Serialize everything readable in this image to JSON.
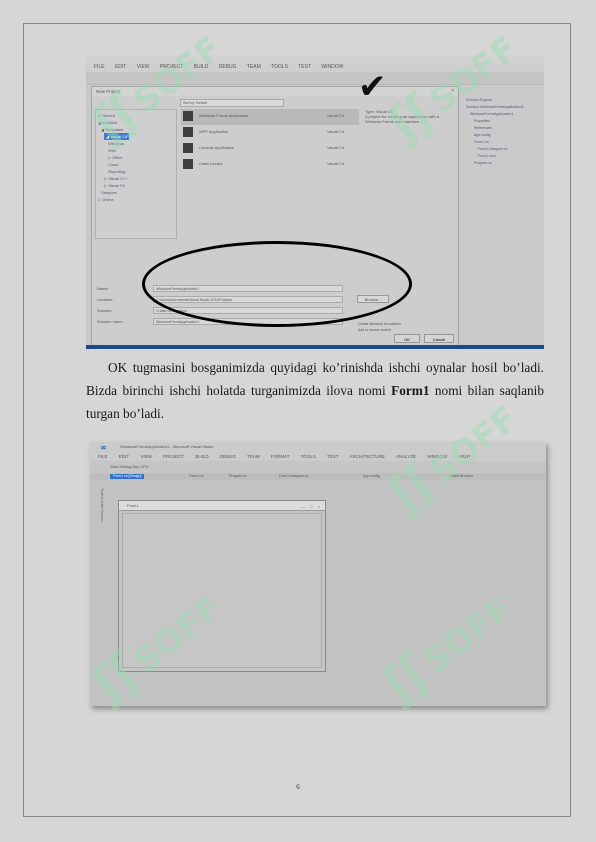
{
  "shot1": {
    "menu": [
      "FILE",
      "EDIT",
      "VIEW",
      "PROJECT",
      "BUILD",
      "DEBUG",
      "TEAM",
      "TOOLS",
      "TEST",
      "WINDOW"
    ],
    "dialog_title": "New Project",
    "close_glyph": "×",
    "sort_select": "Sort by: Default",
    "tree": [
      "▷ Recent",
      "◢ Installed",
      "◢ Templates",
      "◢ Visual C#",
      "Windows",
      "Web",
      "▷ Office",
      "Cloud",
      "Reporting",
      "▷ Visual C++",
      "▷ Visual F#",
      "Samples",
      "▷ Online"
    ],
    "tree_highlight_index": 3,
    "templates": [
      {
        "name": "Windows Forms Application",
        "lang": "Visual C#"
      },
      {
        "name": "WPF Application",
        "lang": "Visual C#"
      },
      {
        "name": "Console Application",
        "lang": "Visual C#"
      },
      {
        "name": "Class Library",
        "lang": "Visual C#"
      }
    ],
    "description_title": "Type: Visual C#",
    "description": "A project for creating an application with a Windows Forms user interface",
    "fields": [
      {
        "label": "Name:",
        "value": "WindowsFormsApplication1"
      },
      {
        "label": "Location:",
        "value": "C:\\Users\\Documents\\Visual Studio 2013\\Projects"
      },
      {
        "label": "Solution:",
        "value": "Create new solution"
      },
      {
        "label": "Solution name:",
        "value": "WindowsFormsApplication1"
      }
    ],
    "browse_label": "Browse...",
    "check1": "Create directory for solution",
    "check2": "Add to source control",
    "ok_label": "OK",
    "cancel_label": "Cancel",
    "solution_items": [
      "Solution Explorer",
      "Solution 'WindowsFormsApplication1'",
      "WindowsFormsApplication1",
      "Properties",
      "References",
      "App.config",
      "Form1.cs",
      "Form1.Designer.cs",
      "Form1.resx",
      "Program.cs"
    ]
  },
  "paragraph": {
    "before_bold": "OK tugmasini bosganimizda quyidagi ko’rinishda ishchi oynalar hosil bo’ladi. Bizda birinchi ishchi holatda turganimizda ilova nomi ",
    "bold": "Form1",
    "after_bold": " nomi bilan saqlanib turgan bo’ladi."
  },
  "shot2": {
    "title": "WindowsFormsApplication1 - Microsoft Visual Studio",
    "menu": [
      "FILE",
      "EDIT",
      "VIEW",
      "PROJECT",
      "BUILD",
      "DEBUG",
      "TEAM",
      "FORMAT",
      "TOOLS",
      "TEST",
      "ARCHITECTURE",
      "ANALYZE",
      "WINDOW",
      "HELP"
    ],
    "toolbar_text": "Start   Debug   Any CPU",
    "tabs": [
      "Form1.cs [Design]",
      "Form1.cs",
      "Program.cs",
      "Form1.Designer.cs",
      "App.config",
      "Object Browser"
    ],
    "left_strip": "Toolbox  Data Sources",
    "form_title": "Form1",
    "form_buttons": "— □ ×"
  },
  "watermark": {
    "logo": "ʃʃ",
    "text": "SOFF"
  },
  "page_number": "6"
}
